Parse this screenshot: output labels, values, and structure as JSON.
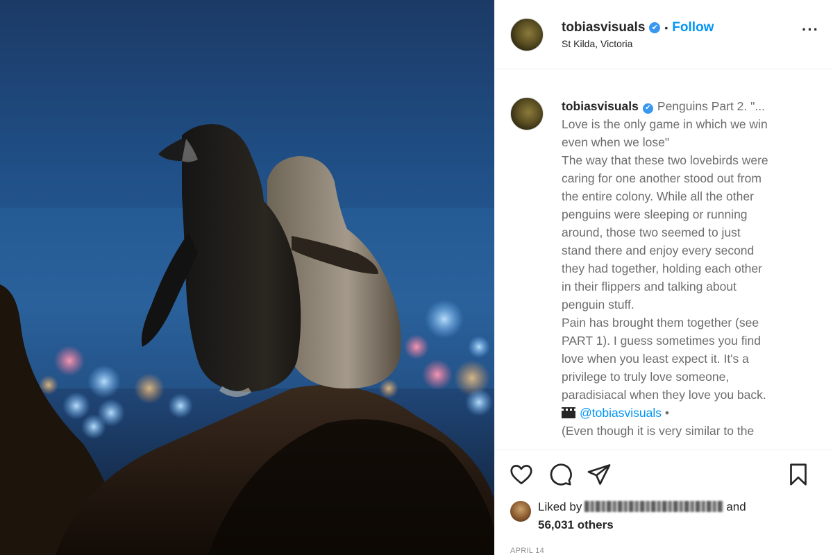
{
  "post": {
    "author": {
      "username": "tobiasvisuals",
      "verified_badge": "✔",
      "follow_label": "Follow",
      "location": "St Kilda, Victoria"
    },
    "more_options_icon": "more-horizontal-icon",
    "caption": {
      "username": "tobiasvisuals",
      "verified_badge": "✔",
      "lines": [
        "Penguins Part 2. \"...",
        "Love is the only game in which we win",
        "even when we lose\"",
        "The way that these two lovebirds were",
        "caring for one another stood out from",
        "the entire colony. While all the other",
        "penguins were sleeping or running",
        "around, those two seemed to just",
        "stand there and enjoy every second",
        "they had together, holding each other",
        "in their flippers and talking about",
        "penguin stuff.",
        "Pain has brought them together (see",
        "PART 1). I guess sometimes you find",
        "love when you least expect it. It's a",
        "privilege to truly love someone,",
        "paradisiacal when they love you back."
      ],
      "credit_icon": "clapper-board-icon",
      "credit_mention": "@tobiasvisuals",
      "credit_suffix": " •",
      "last_line": "(Even though it is very similar to the"
    },
    "actions": {
      "like_icon": "heart-icon",
      "comment_icon": "comment-icon",
      "share_icon": "paper-plane-icon",
      "save_icon": "bookmark-icon"
    },
    "likes": {
      "prefix": "Liked by",
      "suffix": "and",
      "others_count": "56,031 others"
    },
    "date": "APRIL 14"
  },
  "colors": {
    "link_blue": "#0095f6",
    "verified_blue": "#3897f0",
    "text_dark": "#262626",
    "text_muted": "#6d6d6d"
  }
}
